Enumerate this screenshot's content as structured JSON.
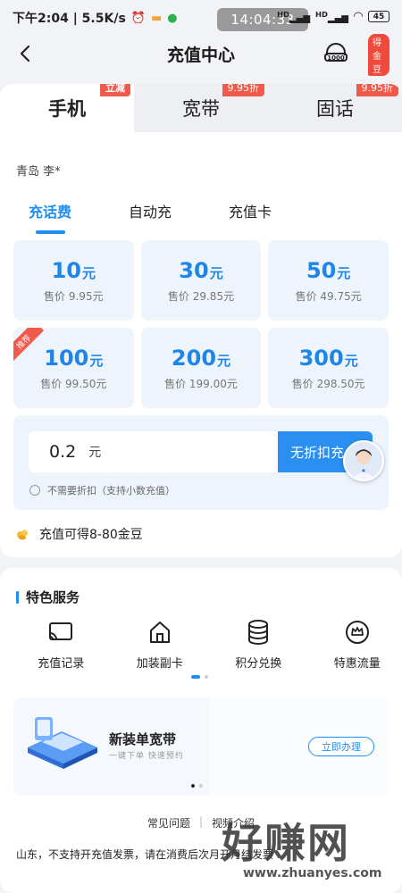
{
  "status_bar": {
    "time_speed": "下午2:04 | 5.5K/s",
    "center_time": "14:04:33",
    "battery": "45",
    "signal1": "HD",
    "signal2": "HD"
  },
  "nav": {
    "title": "充值中心",
    "badge": "得金豆"
  },
  "top_tabs": [
    {
      "label": "手机",
      "badge": "立减",
      "active": true
    },
    {
      "label": "宽带",
      "badge": "9.95折",
      "active": false
    },
    {
      "label": "固话",
      "badge": "9.95折",
      "active": false
    }
  ],
  "user": "青岛 李*",
  "sub_tabs": [
    {
      "label": "充话费",
      "active": true
    },
    {
      "label": "自动充",
      "active": false
    },
    {
      "label": "充值卡",
      "active": false
    }
  ],
  "tiles": [
    {
      "amount": "10",
      "unit": "元",
      "price": "售价 9.95元",
      "ribbon": ""
    },
    {
      "amount": "30",
      "unit": "元",
      "price": "售价 29.85元",
      "ribbon": ""
    },
    {
      "amount": "50",
      "unit": "元",
      "price": "售价 49.75元",
      "ribbon": ""
    },
    {
      "amount": "100",
      "unit": "元",
      "price": "售价 99.50元",
      "ribbon": "推荐"
    },
    {
      "amount": "200",
      "unit": "元",
      "price": "售价 199.00元",
      "ribbon": ""
    },
    {
      "amount": "300",
      "unit": "元",
      "price": "售价 298.50元",
      "ribbon": ""
    }
  ],
  "custom": {
    "value": "0.2",
    "unit": "元",
    "button": "无折扣充",
    "checkbox_label": "不需要折扣（支持小数充值）"
  },
  "bean_text": "充值可得8-80金豆",
  "services": {
    "title": "特色服务",
    "items": [
      {
        "label": "充值记录",
        "icon": "recharge-record-icon"
      },
      {
        "label": "加装副卡",
        "icon": "home-icon"
      },
      {
        "label": "积分兑换",
        "icon": "coins-stack-icon"
      },
      {
        "label": "特惠流量",
        "icon": "crown-icon"
      }
    ]
  },
  "banner": {
    "title": "新装单宽带",
    "subtitle": "一键下单  快速预约",
    "button": "立即办理"
  },
  "links": {
    "faq": "常见问题",
    "sep": "|",
    "video": "视频介绍"
  },
  "notice": "山东，不支持开充值发票，请在消费后次月开月结发票",
  "watermark": {
    "text": "好赚网",
    "url": "www.zhuanyes.com"
  },
  "colors": {
    "accent": "#1f8ef1",
    "badge_red": "#f05a4a",
    "tile_bg": "#eef4fc"
  }
}
